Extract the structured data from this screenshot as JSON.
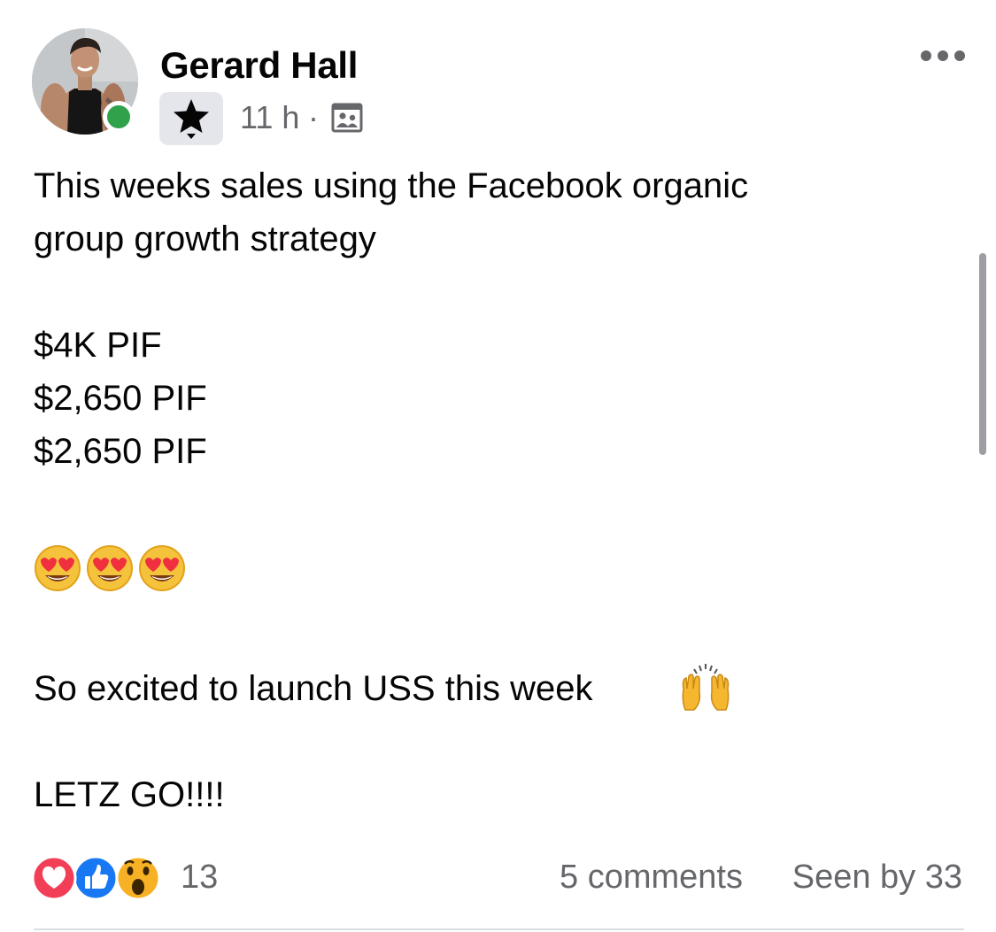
{
  "post": {
    "author": {
      "name": "Gerard Hall",
      "online": true,
      "badge_icon": "star-badge-icon"
    },
    "meta": {
      "time": "11 h",
      "separator": "·",
      "audience_icon": "group-audience-icon"
    },
    "more_icon": "more-options-icon",
    "body": {
      "lines": [
        "This weeks sales using the Facebook organic",
        "group growth strategy",
        "$4K PIF",
        "$2,650 PIF",
        "$2,650 PIF",
        "So excited to launch USS this week",
        "LETZ GO!!!!"
      ],
      "emoji_row": [
        "heart-eyes-emoji",
        "heart-eyes-emoji",
        "heart-eyes-emoji"
      ],
      "inline_emoji": "raising-hands-emoji"
    },
    "footer": {
      "reactions": [
        "love-reaction-icon",
        "like-reaction-icon",
        "wow-reaction-icon"
      ],
      "reaction_count": "13",
      "comments": "5 comments",
      "seen_by": "Seen by 33"
    }
  },
  "colors": {
    "text": "#050505",
    "secondary_text": "#65676b",
    "online_green": "#31a24c",
    "badge_bg": "#e4e6eb",
    "divider": "#dadde1",
    "love_red": "#f33e58",
    "like_blue": "#1877f2",
    "wow_yellow": "#f7b125"
  }
}
